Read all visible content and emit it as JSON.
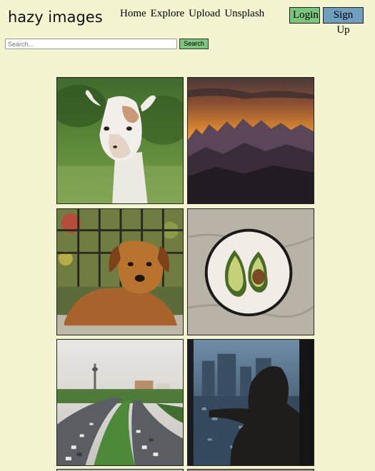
{
  "header": {
    "logo": "hazy images",
    "nav": [
      "Home",
      "Explore",
      "Upload",
      "Unsplash"
    ],
    "login_label": "Login",
    "signup_label": "Sign Up"
  },
  "search": {
    "placeholder": "Search...",
    "value": "",
    "button_label": "Search"
  },
  "gallery": {
    "images": [
      {
        "subject": "alpaca",
        "icon": "alpaca-photo"
      },
      {
        "subject": "mountain sunset",
        "icon": "mountain-sunset-photo"
      },
      {
        "subject": "golden retriever dog",
        "icon": "dog-photo"
      },
      {
        "subject": "avocado on plate",
        "icon": "avocado-photo"
      },
      {
        "subject": "city highway with tower",
        "icon": "city-highway-photo"
      },
      {
        "subject": "woman at window over city",
        "icon": "window-city-photo"
      }
    ]
  },
  "colors": {
    "background": "#f4f4d0",
    "login_button": "#7cc57c",
    "signup_button": "#6f9fbf",
    "search_button": "#7cc57c"
  }
}
